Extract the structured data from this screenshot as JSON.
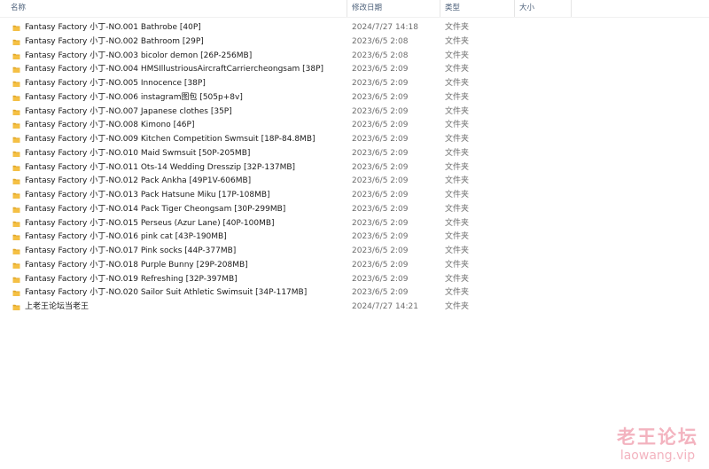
{
  "columns": {
    "name": "名称",
    "date": "修改日期",
    "type": "类型",
    "size": "大小",
    "sort_indicator": "^"
  },
  "icon": "folder-icon",
  "accent_color": "#f5c044",
  "files": [
    {
      "name": "Fantasy Factory 小丁-NO.001 Bathrobe [40P]",
      "date": "2024/7/27 14:18",
      "type": "文件夹"
    },
    {
      "name": "Fantasy Factory 小丁-NO.002 Bathroom [29P]",
      "date": "2023/6/5 2:08",
      "type": "文件夹"
    },
    {
      "name": "Fantasy Factory 小丁-NO.003 bicolor demon [26P-256MB]",
      "date": "2023/6/5 2:08",
      "type": "文件夹"
    },
    {
      "name": "Fantasy Factory 小丁-NO.004 HMSIllustriousAircraftCarriercheongsam [38P]",
      "date": "2023/6/5 2:09",
      "type": "文件夹"
    },
    {
      "name": "Fantasy Factory 小丁-NO.005 Innocence [38P]",
      "date": "2023/6/5 2:09",
      "type": "文件夹"
    },
    {
      "name": "Fantasy Factory 小丁-NO.006 instagram图包 [505p+8v]",
      "date": "2023/6/5 2:09",
      "type": "文件夹"
    },
    {
      "name": "Fantasy Factory 小丁-NO.007 Japanese clothes [35P]",
      "date": "2023/6/5 2:09",
      "type": "文件夹"
    },
    {
      "name": "Fantasy Factory 小丁-NO.008 Kimono [46P]",
      "date": "2023/6/5 2:09",
      "type": "文件夹"
    },
    {
      "name": "Fantasy Factory 小丁-NO.009 Kitchen Competition Swmsuit [18P-84.8MB]",
      "date": "2023/6/5 2:09",
      "type": "文件夹"
    },
    {
      "name": "Fantasy Factory 小丁-NO.010 Maid Swmsuit [50P-205MB]",
      "date": "2023/6/5 2:09",
      "type": "文件夹"
    },
    {
      "name": "Fantasy Factory 小丁-NO.011 Ots-14 Wedding Dresszip [32P-137MB]",
      "date": "2023/6/5 2:09",
      "type": "文件夹"
    },
    {
      "name": "Fantasy Factory 小丁-NO.012 Pack Ankha [49P1V-606MB]",
      "date": "2023/6/5 2:09",
      "type": "文件夹"
    },
    {
      "name": "Fantasy Factory 小丁-NO.013 Pack Hatsune Miku [17P-108MB]",
      "date": "2023/6/5 2:09",
      "type": "文件夹"
    },
    {
      "name": "Fantasy Factory 小丁-NO.014 Pack Tiger Cheongsam [30P-299MB]",
      "date": "2023/6/5 2:09",
      "type": "文件夹"
    },
    {
      "name": "Fantasy Factory 小丁-NO.015 Perseus (Azur Lane) [40P-100MB]",
      "date": "2023/6/5 2:09",
      "type": "文件夹"
    },
    {
      "name": "Fantasy Factory 小丁-NO.016 pink cat [43P-190MB]",
      "date": "2023/6/5 2:09",
      "type": "文件夹"
    },
    {
      "name": "Fantasy Factory 小丁-NO.017 Pink socks [44P-377MB]",
      "date": "2023/6/5 2:09",
      "type": "文件夹"
    },
    {
      "name": "Fantasy Factory 小丁-NO.018 Purple Bunny [29P-208MB]",
      "date": "2023/6/5 2:09",
      "type": "文件夹"
    },
    {
      "name": "Fantasy Factory 小丁-NO.019 Refreshing [32P-397MB]",
      "date": "2023/6/5 2:09",
      "type": "文件夹"
    },
    {
      "name": "Fantasy Factory 小丁-NO.020 Sailor Suit Athletic Swimsuit [34P-117MB]",
      "date": "2023/6/5 2:09",
      "type": "文件夹"
    },
    {
      "name": "上老王论坛当老王",
      "date": "2024/7/27 14:21",
      "type": "文件夹"
    }
  ],
  "watermark": {
    "title": "老王论坛",
    "domain": "laowang.vip"
  }
}
